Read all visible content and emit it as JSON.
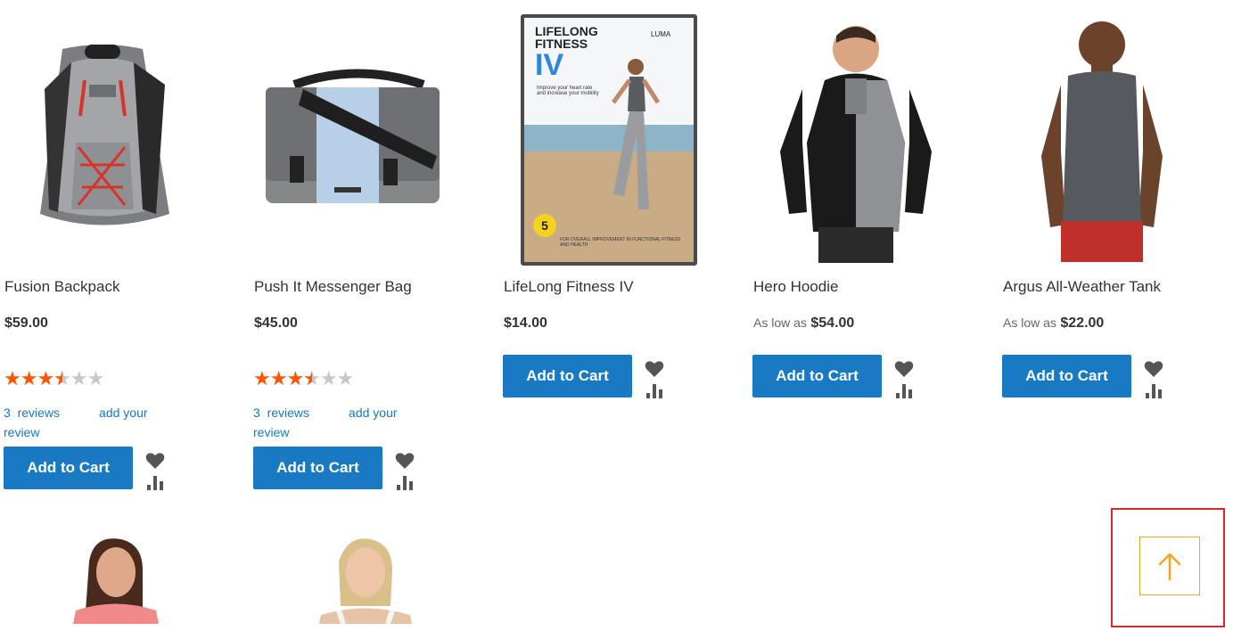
{
  "products": [
    {
      "name": "Fusion Backpack",
      "price": "$59.00",
      "rating": 3.5,
      "stars": {
        "full": "★★★",
        "half": "★",
        "empty": "★★"
      },
      "reviews_count": "3  reviews",
      "add_review": "add your review",
      "cart_label": "Add to Cart"
    },
    {
      "name": "Push It Messenger Bag",
      "price": "$45.00",
      "rating": 3.5,
      "stars": {
        "full": "★★★",
        "half": "★",
        "empty": "★★"
      },
      "reviews_count": "3  reviews",
      "add_review": "add your review",
      "cart_label": "Add to Cart"
    },
    {
      "name": "LifeLong Fitness IV",
      "price": "$14.00",
      "cart_label": "Add to Cart",
      "cover": {
        "title": "LIFELONG\nFITNESS",
        "numeral": "IV",
        "brand": "LUMA",
        "tagline": "Improve your heart rate and increase your mobility",
        "badge": "5",
        "footer": "FOR OVERALL IMPROVEMENT IN FUNCTIONAL FITNESS AND HEALTH"
      }
    },
    {
      "name": "Hero Hoodie",
      "price_prefix": "As low as",
      "price": "$54.00",
      "cart_label": "Add to Cart"
    },
    {
      "name": "Argus All-Weather Tank",
      "price_prefix": "As low as",
      "price": "$22.00",
      "cart_label": "Add to Cart"
    }
  ],
  "icons": {
    "wishlist": "heart-icon",
    "compare": "compare-bars-icon",
    "scroll_top": "arrow-up-icon"
  },
  "colors": {
    "button": "#1979c3",
    "link": "#1979c3",
    "star_on": "#ff5501",
    "star_off": "#c7c7c7",
    "highlight_frame": "#d9272e",
    "scroll_accent": "#f5a623"
  }
}
